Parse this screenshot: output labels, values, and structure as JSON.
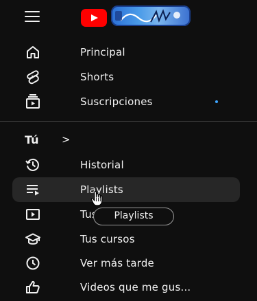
{
  "header": {
    "menu_icon": "hamburger-menu-icon",
    "logo_icon": "youtube-logo-icon",
    "doodle_icon": "doodle-logo-icon"
  },
  "colors": {
    "background": "#0f0f0f",
    "text": "#f1f1f1",
    "hover": "#272727",
    "accent_dot": "#3ea6ff",
    "brand_red": "#ff0000"
  },
  "main_nav": [
    {
      "label": "Principal",
      "icon": "home-icon"
    },
    {
      "label": "Shorts",
      "icon": "shorts-icon"
    },
    {
      "label": "Suscripciones",
      "icon": "subscriptions-icon"
    }
  ],
  "you_section": {
    "title": "Tú",
    "chevron": ">",
    "items": [
      {
        "label": "Historial",
        "icon": "history-icon"
      },
      {
        "label": "Playlists",
        "icon": "playlists-icon"
      },
      {
        "label": "Tus videos",
        "icon": "your-videos-icon"
      },
      {
        "label": "Tus cursos",
        "icon": "courses-icon"
      },
      {
        "label": "Ver más tarde",
        "icon": "watch-later-icon"
      },
      {
        "label": "Videos que me gus...",
        "icon": "liked-videos-icon"
      }
    ]
  },
  "tooltip": {
    "text": "Playlists"
  },
  "hovered_item": "Playlists"
}
